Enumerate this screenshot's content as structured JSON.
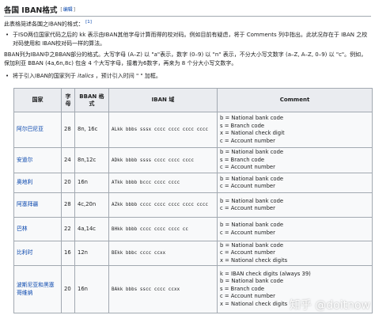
{
  "heading": {
    "title": "各国 IBAN格式",
    "edit_bracket_open": "[",
    "edit_label": "编辑",
    "edit_bracket_close": "]"
  },
  "intro": {
    "text": "此表格简述各国之IBAN的格式：",
    "citation": "[1]"
  },
  "bullet1": {
    "mark": "•",
    "text": "于ISO两位国家代码之后的 kk 表示由IBAN其他字母计算而得的校对码。例如目前有疑虑，将于 Comments 列中指出。此状况存在于 IBAN 之校对码使用和 IBAN校对码一样的算法。"
  },
  "para2": {
    "text": "BBAN列为IBAN中之BBAN部分的格式。大写字母 (A–Z) 以 \"a\"表示，数字 (0–9) 以 \"n\" 表示，不分大小写文数字 (a–Z, A–Z, 0–9) 以 \"c\"。例如，保加利亚 BBAN (4a,6n,8c) 包含 4 个大写字母，接着为6数字，再来为 8 个分大小写文数字。"
  },
  "bullet2": {
    "mark": "•",
    "text_before": "将于引入IBAN的国家列于",
    "italic_text": "italics",
    "text_after": "，预计引入时间 \" \" 加框。"
  },
  "table": {
    "headers": [
      "国家",
      "字母",
      "BBAN 格式",
      "IBAN 域",
      "Comment"
    ],
    "rows": [
      {
        "country": "阿尔巴尼亚",
        "chars": "28",
        "bban": "8n, 16c",
        "code": "ALkk bbbs sssx cccc cccc cccc cccc",
        "comment": [
          "b = National bank code",
          "s = Branch code",
          "x = National check digit",
          "c = Account number"
        ]
      },
      {
        "country": "安道尔",
        "chars": "24",
        "bban": "8n,12c",
        "code": "ADkk bbbb ssss cccc cccc cccc",
        "comment": [
          "b = National bank code",
          "s = Branch code",
          "c = Account number"
        ]
      },
      {
        "country": "奥地利",
        "chars": "20",
        "bban": "16n",
        "code": "ATkk bbbb bccc cccc cccc",
        "comment": [
          "b = National bank code",
          "c = Account number"
        ]
      },
      {
        "country": "阿塞拜疆",
        "chars": "28",
        "bban": "4c,20n",
        "code": "AZkk bbbb cccc cccc cccc cccc cccc",
        "comment": [
          "b = National bank code",
          "c = Account number"
        ]
      },
      {
        "country": "巴林",
        "chars": "22",
        "bban": "4a,14c",
        "code": "BHkk bbbb cccc cccc cccc cc",
        "comment": [
          "b = National bank code",
          "c = Account number"
        ]
      },
      {
        "country": "比利时",
        "chars": "16",
        "bban": "12n",
        "code": "BEkk bbbc cccc ccxx",
        "comment": [
          "b = National bank code",
          "c = Account number",
          "x = National check digits"
        ]
      },
      {
        "country": "波斯尼亚和黑塞哥维纳",
        "chars": "20",
        "bban": "16n",
        "code": "BAkk bbbs sscc cccc ccxx",
        "comment": [
          "k = IBAN check digits (always 39)",
          "b = National bank code",
          "s = Branch code",
          "c = Account number",
          "x = National check digits"
        ]
      }
    ]
  },
  "watermark": {
    "text": "知乎 @doitnow"
  }
}
